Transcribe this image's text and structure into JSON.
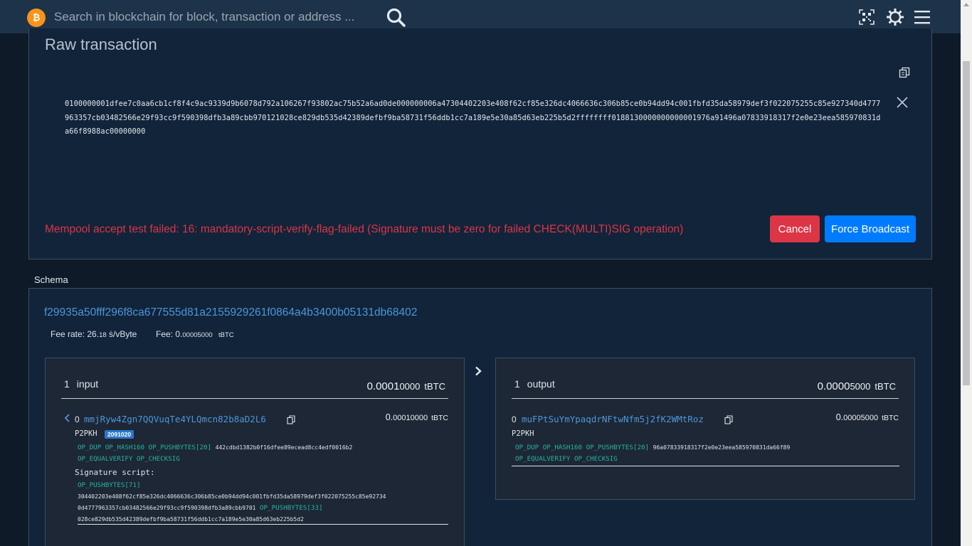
{
  "nav": {
    "logo_glyph": "₿",
    "search_placeholder": "Search in blockchain for block, transaction or address ..."
  },
  "raw": {
    "title": "Raw transaction",
    "hex": "0100000001dfee7c0aa6cb1cf8f4c9ac9339d9b6078d792a106267f93802ac75b52a6ad0de000000006a47304402203e408f62cf85e326dc4066636c306b85ce0b94dd94c001fbfd35da58979def3f022075255c85e927340d4777963357cb03482566e29f93cc9f590398dfb3a89cbb970121028ce829db535d42389defbf9ba58731f56ddb1cc7a189e5e30a85d63eb225b5d2ffffffff0188130000000000001976a91496a07833918317f2e0e23eea585970831da66f8988ac00000000",
    "error": "Mempool accept test failed: 16: mandatory-script-verify-flag-failed (Signature must be zero for failed CHECK(MULTI)SIG operation)",
    "cancel_label": "Cancel",
    "force_label": "Force Broadcast"
  },
  "schema": {
    "label": "Schema",
    "txid": "f29935a50fff296f8ca677555d81a2155929261f0864a4b3400b05131db68402",
    "fee_rate_label": "Fee rate:",
    "fee_rate_main": "26.",
    "fee_rate_small": "18",
    "fee_rate_unit": "ṡ/vByte",
    "fee_label": "Fee:",
    "fee_main": "0.",
    "fee_small": "00005000",
    "fee_unit": "tBTC",
    "input": {
      "count": "1",
      "label": "input",
      "total_main": "0.0001",
      "total_small": "0000",
      "total_unit": "tBTC",
      "items": [
        {
          "index": "0",
          "address": "mmjRyw4Zgn7QQVuqTe4YLQmcn82b8aD2L6",
          "amount_main": "0.",
          "amount_small": "00010000",
          "unit": "tBTC",
          "type": "P2PKH",
          "block_badge": "2091020",
          "script_ops_1": "OP_DUP OP_HASH160 OP_PUSHBYTES[20]",
          "script_hex_1": "442cdbd1382b0f16dfee89ecead8cc4edf0016b2",
          "script_ops_2": "OP_EQUALVERIFY OP_CHECKSIG",
          "sig_label": "Signature script:",
          "sig_op_1": "OP_PUSHBYTES[71]",
          "sig_hex_1": "304402203e408f62cf85e326dc4066636c306b85ce0b94dd94c001fbfd35da58979def3f022075255c85e92734",
          "sig_hex_2": "0d4777963357cb03482566e29f93cc9f590398dfb3a89cbb9701",
          "sig_op_2": "OP_PUSHBYTES[33]",
          "sig_hex_3": "028ce829db535d42389defbf9ba58731f56ddb1cc7a189e5e30a85d63eb225b5d2"
        }
      ]
    },
    "output": {
      "count": "1",
      "label": "output",
      "total_main": "0.0000",
      "total_small": "5000",
      "total_unit": "tBTC",
      "items": [
        {
          "index": "0",
          "address": "muFPtSuYmYpaqdrNFtwNfm5j2fK2WMtRoz",
          "amount_main": "0.",
          "amount_small": "00005000",
          "unit": "tBTC",
          "type": "P2PKH",
          "script_ops_1": "OP_DUP OP_HASH160 OP_PUSHBYTES[20]",
          "script_hex_1": "96a07833918317f2e0e23eea585970831da66f89",
          "script_ops_2": "OP_EQUALVERIFY OP_CHECKSIG"
        }
      ]
    }
  },
  "colors": {
    "nav_bg": "#1d3349",
    "panel_bg": "#11243a",
    "link": "#4d96d9",
    "error": "#dc3545",
    "primary": "#007bff",
    "op_code": "#27b3a0"
  }
}
